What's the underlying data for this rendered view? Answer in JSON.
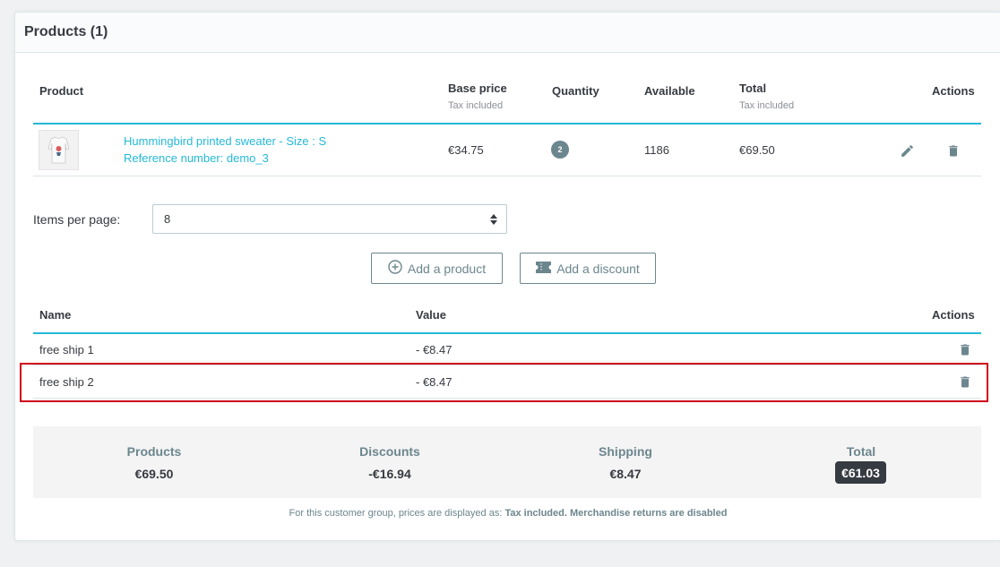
{
  "card": {
    "title": "Products (1)"
  },
  "products_table": {
    "headers": {
      "product": "Product",
      "base_price": "Base price",
      "base_price_sub": "Tax included",
      "quantity": "Quantity",
      "available": "Available",
      "total": "Total",
      "total_sub": "Tax included",
      "actions": "Actions"
    },
    "rows": [
      {
        "name": "Hummingbird printed sweater - Size : S",
        "reference": "Reference number: demo_3",
        "base_price": "€34.75",
        "quantity": "2",
        "available": "1186",
        "total": "€69.50"
      }
    ]
  },
  "pagination": {
    "label": "Items per page:",
    "value": "8"
  },
  "buttons": {
    "add_product": "Add a product",
    "add_discount": "Add a discount"
  },
  "discounts_table": {
    "headers": {
      "name": "Name",
      "value": "Value",
      "actions": "Actions"
    },
    "rows": [
      {
        "name": "free ship 1",
        "value": "- €8.47"
      },
      {
        "name": "free ship 2",
        "value": "- €8.47"
      }
    ]
  },
  "summary": {
    "products_label": "Products",
    "products_value": "€69.50",
    "discounts_label": "Discounts",
    "discounts_value": "-€16.94",
    "shipping_label": "Shipping",
    "shipping_value": "€8.47",
    "total_label": "Total",
    "total_value": "€61.03"
  },
  "footnote": {
    "prefix": "For this customer group, prices are displayed as:",
    "tax": "Tax included",
    "returns": "Merchandise returns are disabled"
  },
  "colors": {
    "accent": "#25b9d7",
    "highlight": "#d0021b",
    "dark": "#363a41"
  }
}
